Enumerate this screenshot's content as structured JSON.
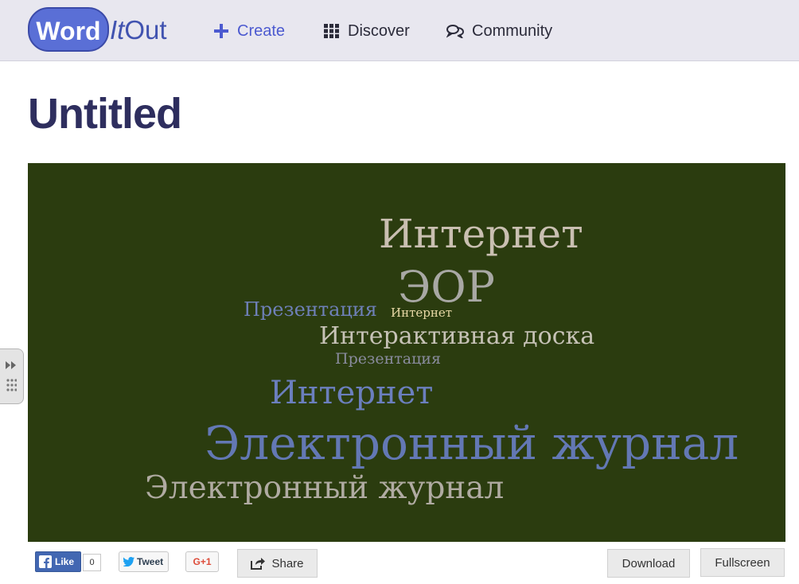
{
  "brand": {
    "word": "Word",
    "it": "It",
    "out": "Out"
  },
  "nav": [
    {
      "label": "Create",
      "icon": "plus-icon"
    },
    {
      "label": "Discover",
      "icon": "grid-icon"
    },
    {
      "label": "Community",
      "icon": "chat-bubbles-icon"
    }
  ],
  "page": {
    "title": "Untitled"
  },
  "cloud": {
    "background": "#2b3c0f",
    "words": [
      {
        "text": "Интернет",
        "color": "#c9bfb1"
      },
      {
        "text": "ЭОР",
        "color": "#a8a8a4"
      },
      {
        "text": "Презентация",
        "color": "#6e80b8"
      },
      {
        "text": "Интернет",
        "color": "#e8d9a6"
      },
      {
        "text": "Интерактивная доска",
        "color": "#c6c2b6"
      },
      {
        "text": "Презентация",
        "color": "#8a8c9f"
      },
      {
        "text": "Интернет",
        "color": "#6b7fbe"
      },
      {
        "text": "Электронный журнал",
        "color": "#6378b4"
      },
      {
        "text": "Электронный журнал",
        "color": "#b0aba2"
      }
    ]
  },
  "social": {
    "like_label": "Like",
    "like_count": "0",
    "tweet_label": "Tweet",
    "gplus_label": "G+1"
  },
  "actions": {
    "share_label": "Share",
    "download_label": "Download",
    "fullscreen_label": "Fullscreen"
  }
}
